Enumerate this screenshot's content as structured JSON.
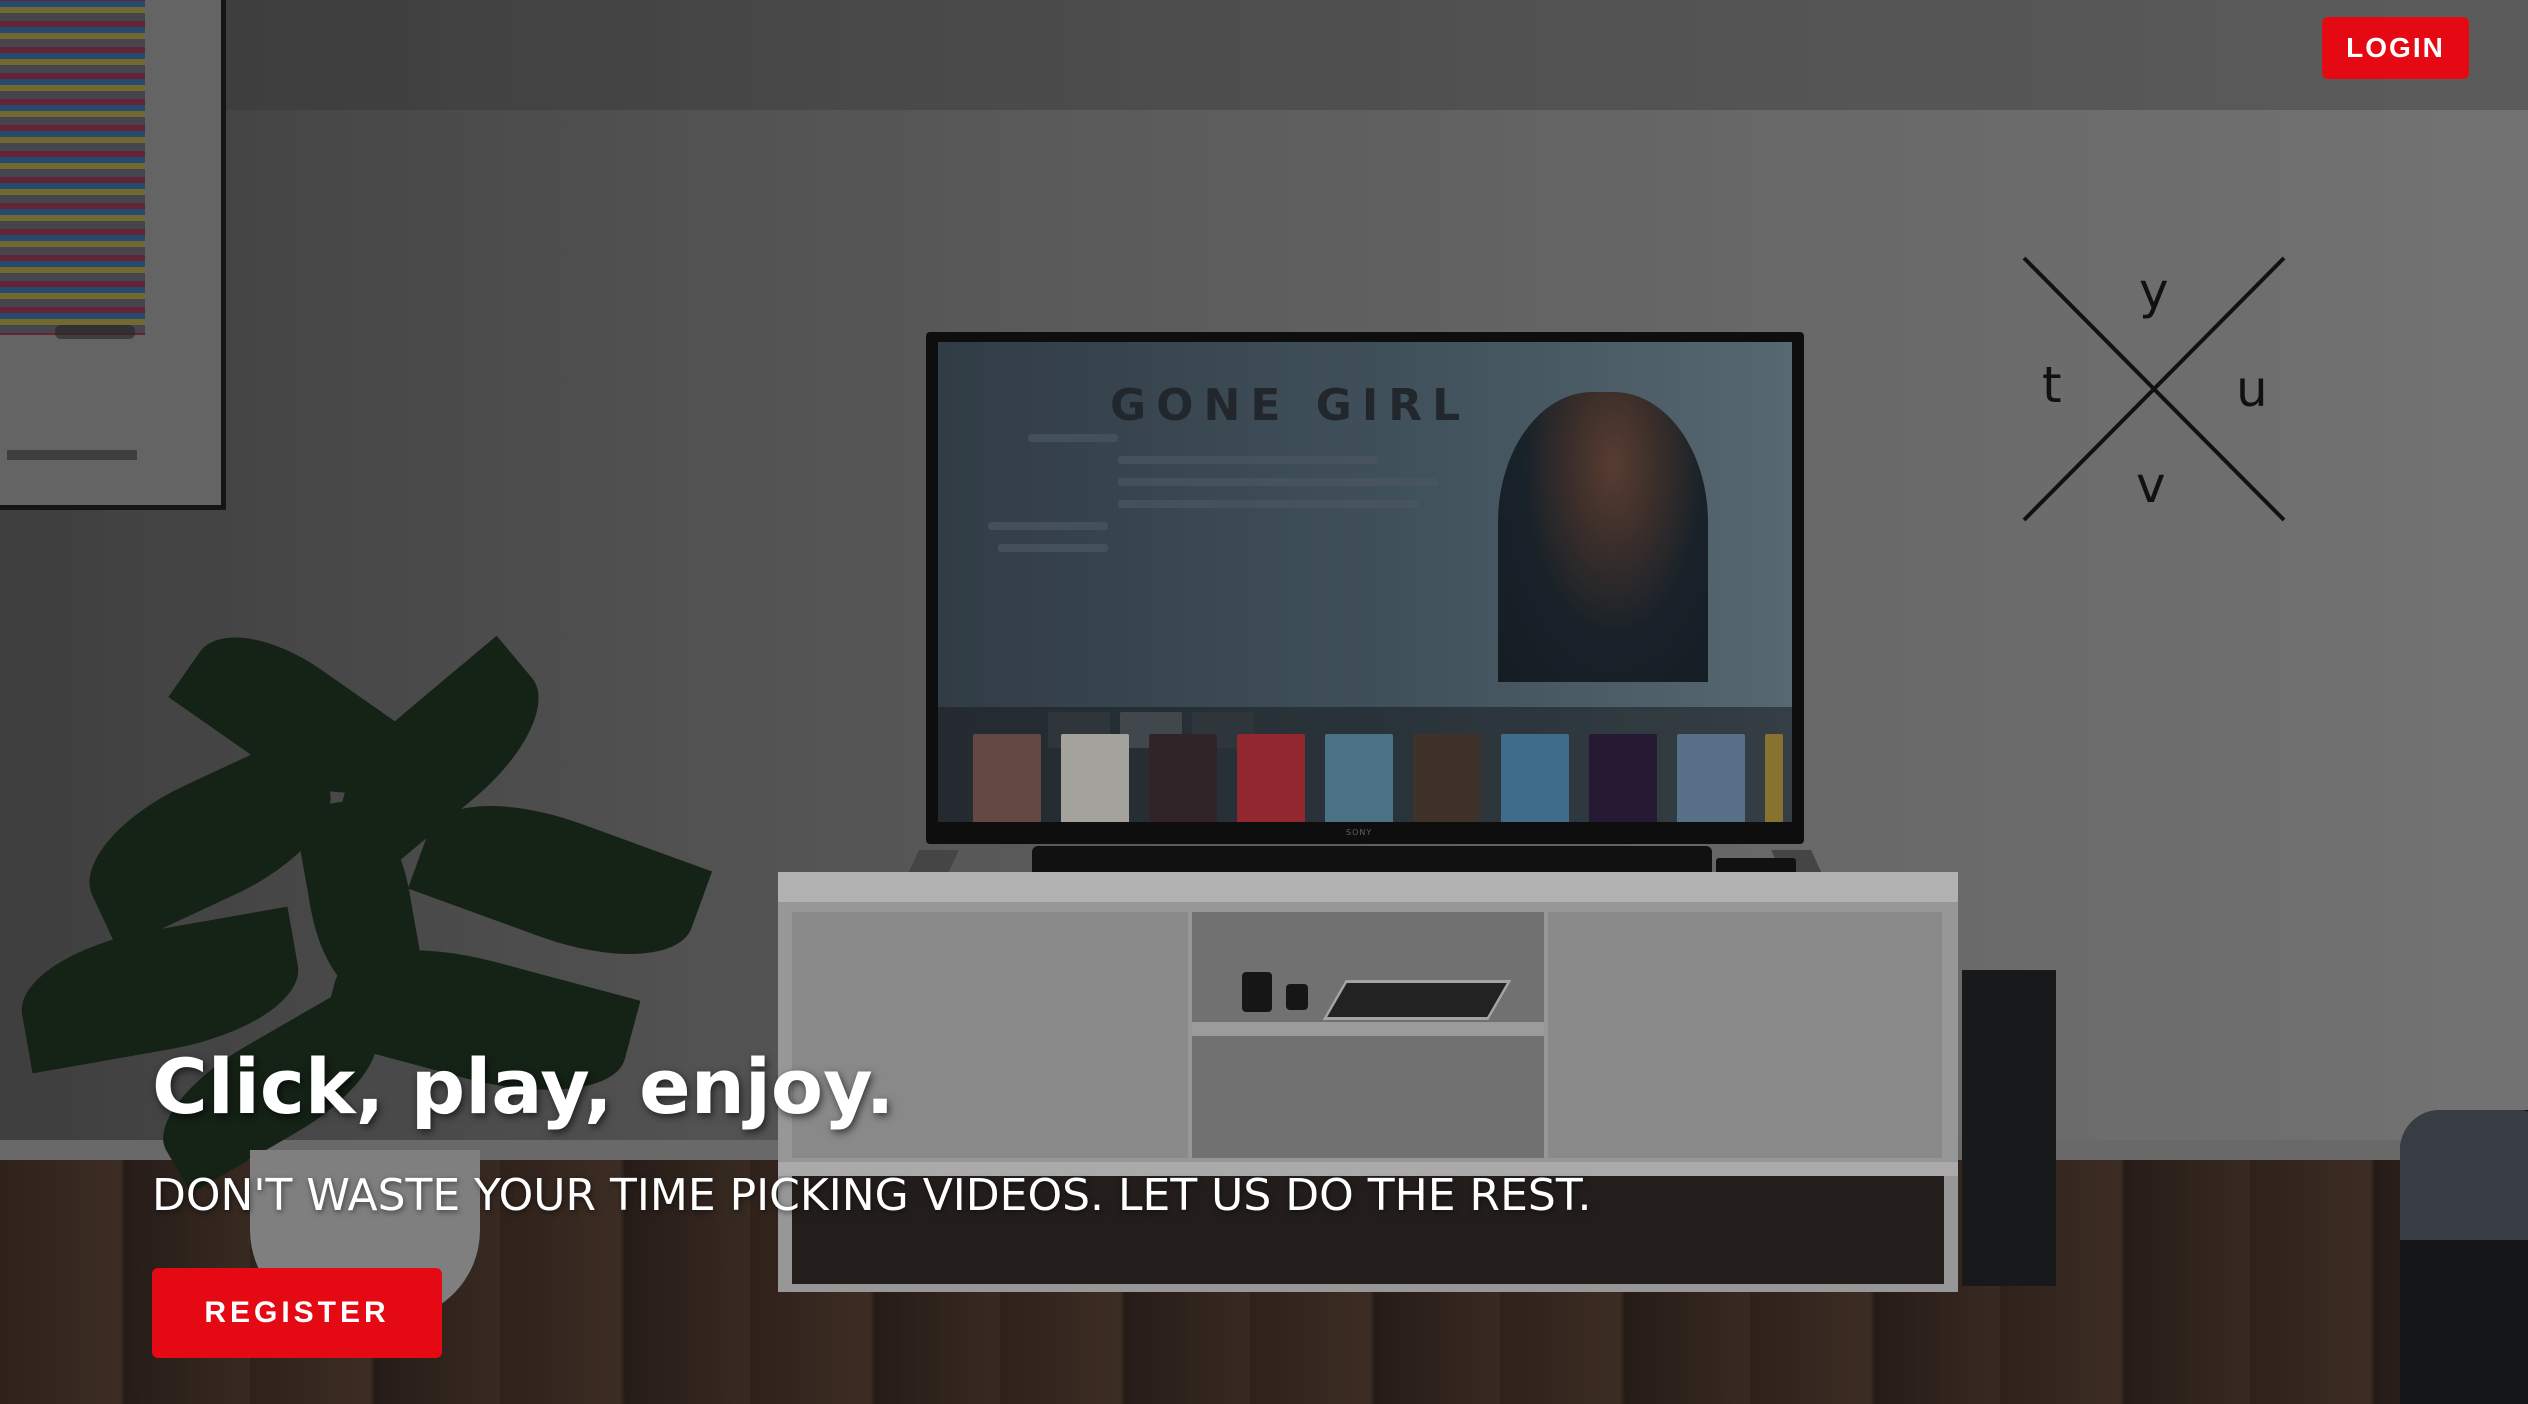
{
  "header": {
    "login_label": "LOGIN"
  },
  "logo": {
    "letters": {
      "top": "y",
      "left": "t",
      "right": "u",
      "bottom": "v"
    }
  },
  "hero": {
    "title": "Click, play, enjoy.",
    "subtitle": "DON'T WASTE YOUR TIME PICKING VIDEOS. LET US DO THE REST.",
    "register_label": "REGISTER"
  },
  "background": {
    "tv_screen_title": "GONE GIRL",
    "tv_brand": "SONY"
  },
  "colors": {
    "accent": "#e50914",
    "text": "#ffffff",
    "logo_ink": "#111111"
  }
}
